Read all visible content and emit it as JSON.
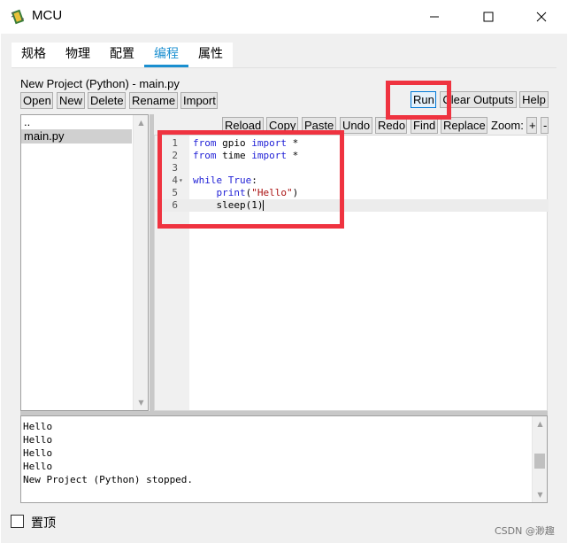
{
  "window": {
    "title": "MCU"
  },
  "tabs": [
    {
      "label": "规格",
      "active": false
    },
    {
      "label": "物理",
      "active": false
    },
    {
      "label": "配置",
      "active": false
    },
    {
      "label": "编程",
      "active": true
    },
    {
      "label": "属性",
      "active": false
    }
  ],
  "project": {
    "title": "New Project (Python) - main.py"
  },
  "toolbar": {
    "open": "Open",
    "new": "New",
    "delete": "Delete",
    "rename": "Rename",
    "import": "Import",
    "run": "Run",
    "clear_outputs": "Clear Outputs",
    "help": "Help"
  },
  "editor_toolbar": {
    "reload": "Reload",
    "copy": "Copy",
    "paste": "Paste",
    "undo": "Undo",
    "redo": "Redo",
    "find": "Find",
    "replace": "Replace",
    "zoom_label": "Zoom:",
    "zoom_in": "+",
    "zoom_out": "-"
  },
  "files": [
    {
      "name": "..",
      "selected": false
    },
    {
      "name": "main.py",
      "selected": true
    }
  ],
  "editor": {
    "line_numbers": [
      "1",
      "2",
      "3",
      "4",
      "5",
      "6"
    ],
    "lines": {
      "l1_kw1": "from",
      "l1_mod": " gpio ",
      "l1_kw2": "import",
      "l1_rest": " *",
      "l2_kw1": "from",
      "l2_mod": " time ",
      "l2_kw2": "import",
      "l2_rest": " *",
      "l4_kw1": "while",
      "l4_sp": " ",
      "l4_kw2": "True",
      "l4_rest": ":",
      "l5_indent": "    ",
      "l5_fn": "print",
      "l5_open": "(",
      "l5_str": "\"Hello\"",
      "l5_close": ")",
      "l6_code": "    sleep(1)"
    },
    "fold_marker": "▾",
    "active_line": 6
  },
  "output": {
    "lines": [
      "Hello",
      "Hello",
      "Hello",
      "Hello",
      "New Project (Python) stopped."
    ]
  },
  "footer": {
    "pin_label": "置顶",
    "watermark": "CSDN @渺趣"
  },
  "colors": {
    "accent": "#1a8fd0",
    "annotation": "#ef3340",
    "keyword": "#1f1fd6",
    "string": "#aa1111"
  }
}
